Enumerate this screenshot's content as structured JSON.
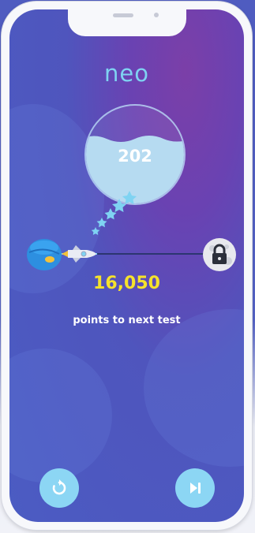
{
  "app": {
    "logo_text": "neo"
  },
  "score": {
    "value": "202"
  },
  "progress": {
    "points_value": "16,050",
    "points_label": "points to next test"
  },
  "controls": {
    "replay_icon": "replay-icon",
    "next_icon": "skip-next-icon"
  },
  "colors": {
    "accent": "#7fd3f2",
    "points": "#f5e22c",
    "button": "#8cd6f4"
  }
}
